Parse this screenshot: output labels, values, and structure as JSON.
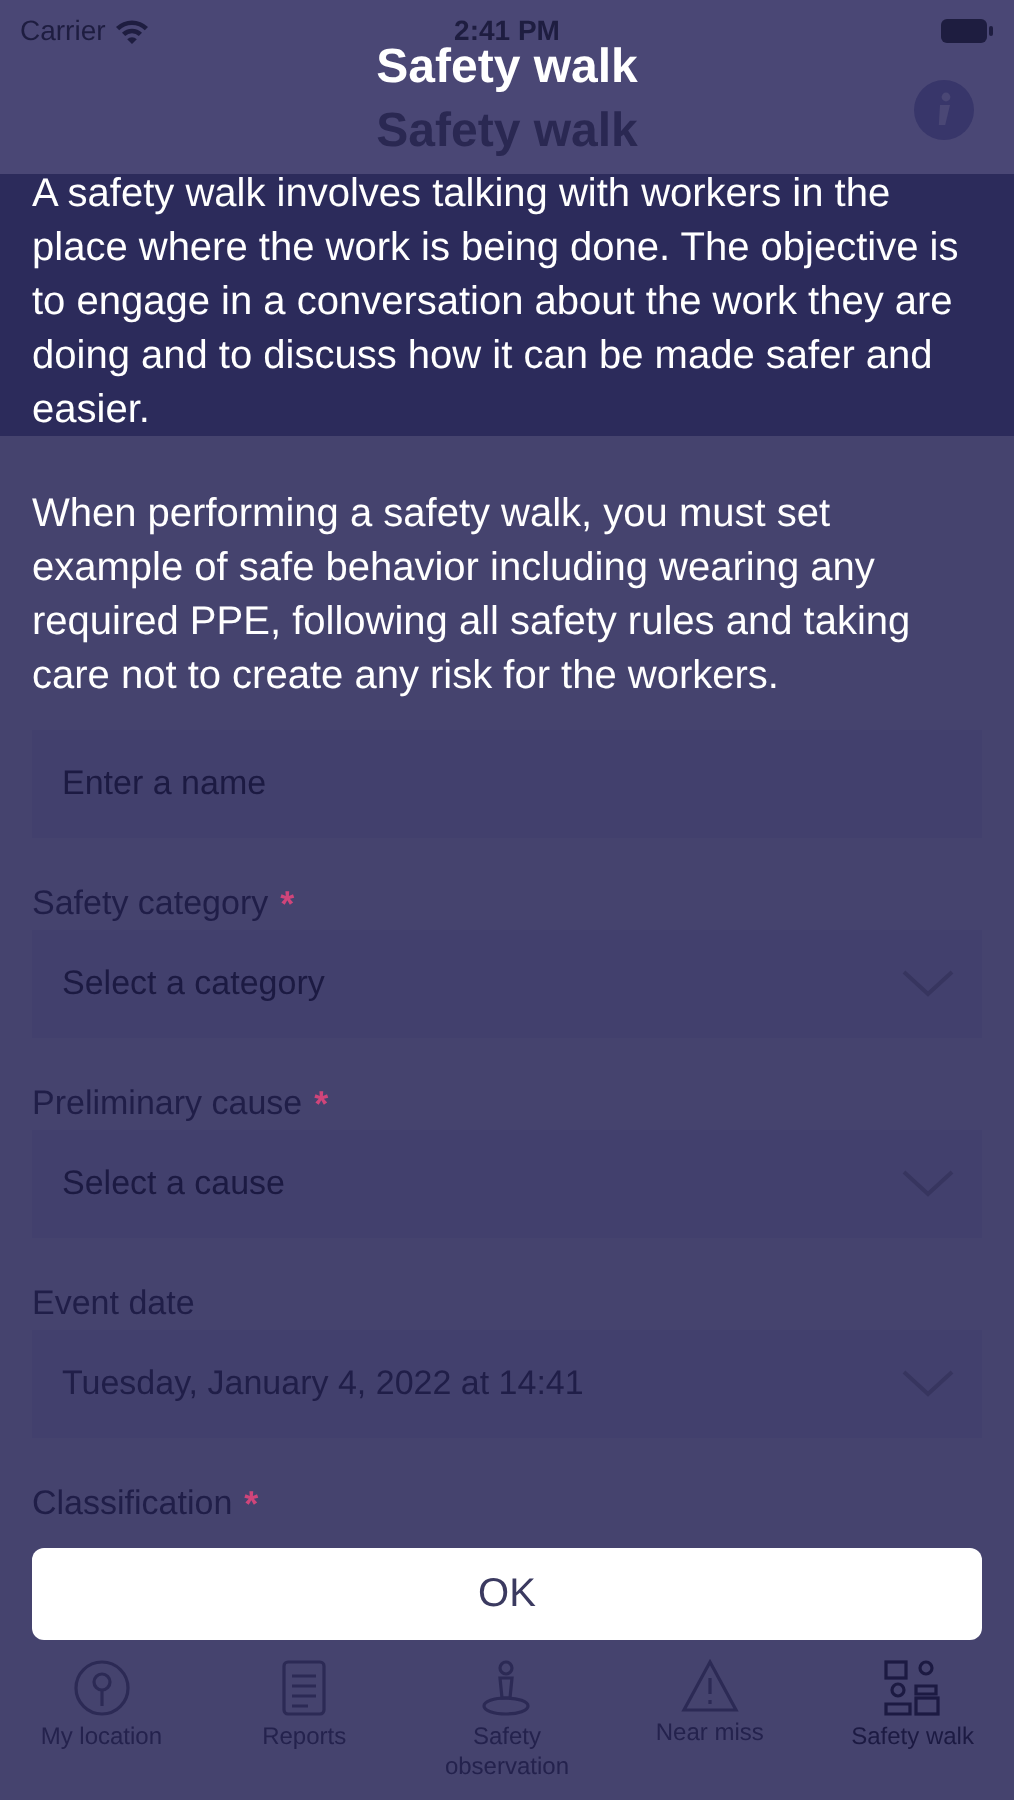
{
  "status_bar": {
    "carrier": "Carrier",
    "time": "2:41 PM"
  },
  "header": {
    "title": "Safety walk"
  },
  "form": {
    "fields": [
      {
        "kind": "input",
        "placeholder": "Enter a name"
      },
      {
        "kind": "select",
        "label": "Safety category",
        "required_mark": "*",
        "placeholder": "Select a category"
      },
      {
        "kind": "select",
        "label": "Preliminary cause",
        "required_mark": "*",
        "placeholder": "Select a cause"
      },
      {
        "kind": "select",
        "label": "Event date",
        "value": "Tuesday, January 4, 2022 at 14:41"
      },
      {
        "kind": "heading",
        "label": "Classification",
        "required_mark": "*"
      }
    ]
  },
  "tab_bar": [
    {
      "label": "My location",
      "selected": false
    },
    {
      "label": "Reports",
      "selected": false
    },
    {
      "label": "Safety observation",
      "selected": false
    },
    {
      "label": "Near miss",
      "selected": false
    },
    {
      "label": "Safety walk",
      "selected": true
    }
  ],
  "dialog": {
    "title": "Safety walk",
    "paragraphs": [
      "A safety walk involves talking with workers in the place where the work is being done. The objective is to engage in a conversation about the work they are doing and to discuss how it can be made safer and easier.",
      "When performing a safety walk, you must set example of safe behavior including wearing any required PPE, following all safety rules and taking care not to create any risk for the workers."
    ],
    "button": "OK"
  }
}
